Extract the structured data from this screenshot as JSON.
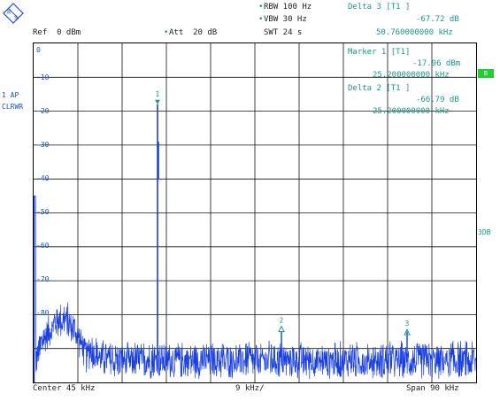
{
  "header": {
    "rbw_bullet": "•",
    "rbw": "RBW 100 Hz",
    "vbw": "VBW 30 Hz",
    "swt": "SWT 24 s",
    "ref": "Ref  0 dBm",
    "att": "Att  20 dB",
    "delta3_title": "Delta 3 [T1 ]",
    "delta3_value": "-67.72 dB",
    "delta3_freq": "50.760000000 kHz"
  },
  "markers_panel": {
    "marker1_title": "Marker 1 [T1]",
    "marker1_value": "-17.96 dBm",
    "marker1_freq": "25.200000000 kHz",
    "delta2_title": "Delta 2 [T1 ]",
    "delta2_value": "-66.79 dB",
    "delta2_freq": "25.200000000 kHz"
  },
  "side_labels": {
    "trace_mode_1": "1 AP",
    "trace_mode_2": "CLRWR",
    "green_box": "B",
    "right_3db": "3DB"
  },
  "plot_labels": {
    "top_zero": "0",
    "bottom_zero": "0",
    "y_ticks": [
      "-10",
      "-20",
      "-30",
      "-40",
      "-50",
      "-60",
      "-70",
      "-80"
    ],
    "marker_numbers": [
      "1",
      "2",
      "3"
    ]
  },
  "footer": {
    "center": "Center 45 kHz",
    "div": "9 kHz/",
    "span": "Span 90 kHz"
  },
  "chart_data": {
    "type": "line",
    "x_unit": "kHz",
    "y_unit": "dBm",
    "xlim": [
      0,
      90
    ],
    "ylim": [
      -100,
      0
    ],
    "grid": true,
    "series": [
      {
        "name": "",
        "color": "#1a3fe0",
        "noise_floor_dbm": -92,
        "shoulder": {
          "x_range": [
            0.5,
            11
          ],
          "peak_dbm": -80
        },
        "spike_at_khz": 25.2,
        "spike_dbm": -17.96,
        "small_peaks_khz": [
          50.4,
          75.96
        ]
      }
    ],
    "markers": [
      {
        "label": "1",
        "x": 25.2,
        "y": -17.96
      },
      {
        "label": "2",
        "x": 50.4,
        "y": -84.75
      },
      {
        "label": "3",
        "x": 75.96,
        "y": -85.68
      }
    ]
  }
}
